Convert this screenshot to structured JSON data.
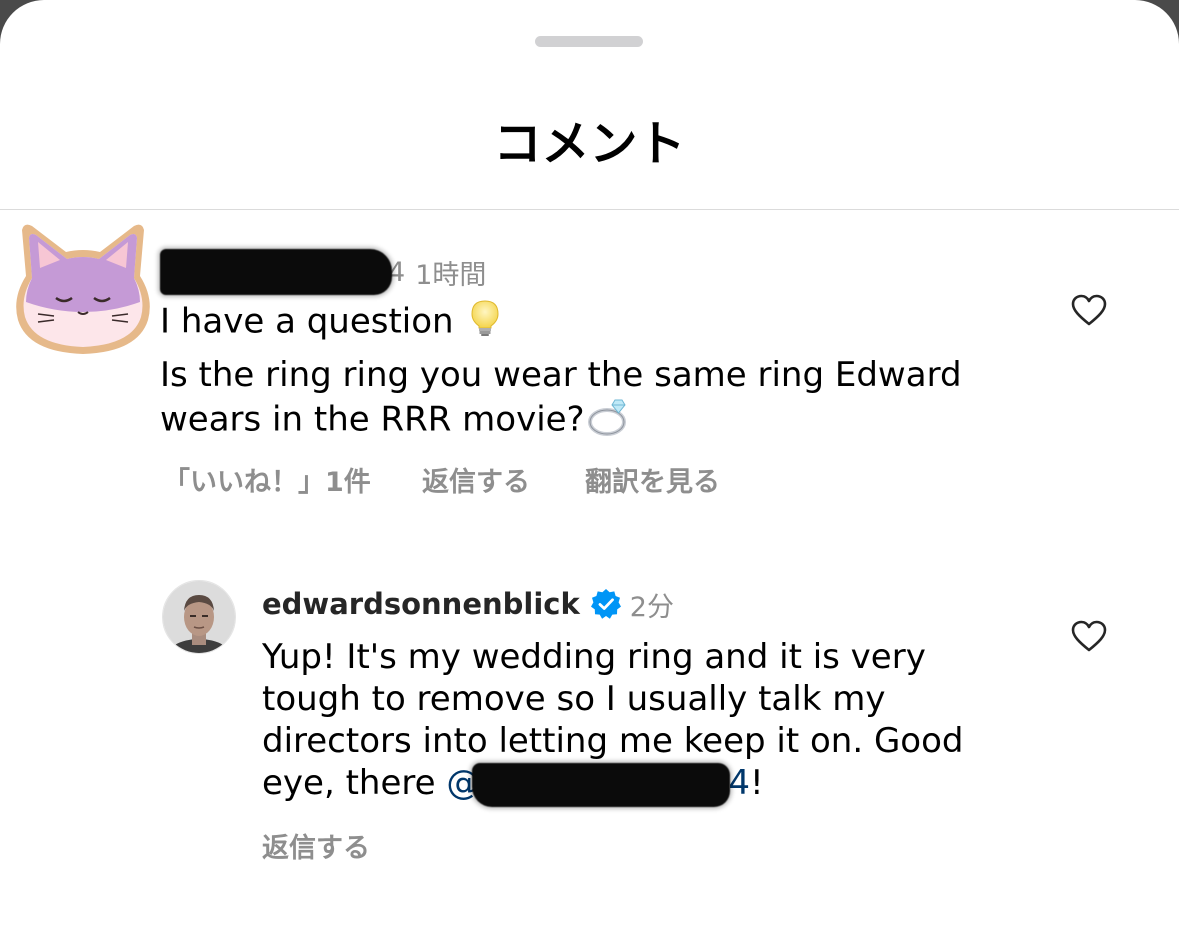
{
  "sheet": {
    "title": "コメント"
  },
  "comments": [
    {
      "username_suffix": "4",
      "timestamp": "1時間",
      "lines": [
        "I have a question",
        "Is the ring ring you wear the same ring Edward",
        "wears in the RRR movie?"
      ],
      "emojis": [
        "lightbulb-emoji",
        "ring-emoji"
      ],
      "actions": {
        "likes": "「いいね！」1件",
        "reply": "返信する",
        "translate": "翻訳を見る"
      }
    },
    {
      "username": "edwardsonnenblick",
      "verified": true,
      "timestamp": "2分",
      "lines": [
        "Yup! It's my wedding ring and it is very",
        "tough to remove so I usually talk my",
        "directors into letting me keep it on. Good",
        "eye, there"
      ],
      "mention_prefix": "@",
      "mention_suffix": "4",
      "trailing": "!",
      "actions": {
        "reply": "返信する"
      }
    }
  ],
  "colors": {
    "secondary_text": "#8e8e8e",
    "mention": "#00376b",
    "verified_badge": "#0095f6",
    "divider": "#dbdbdb"
  },
  "icons": [
    "heart-outline-icon",
    "verified-badge-icon"
  ]
}
